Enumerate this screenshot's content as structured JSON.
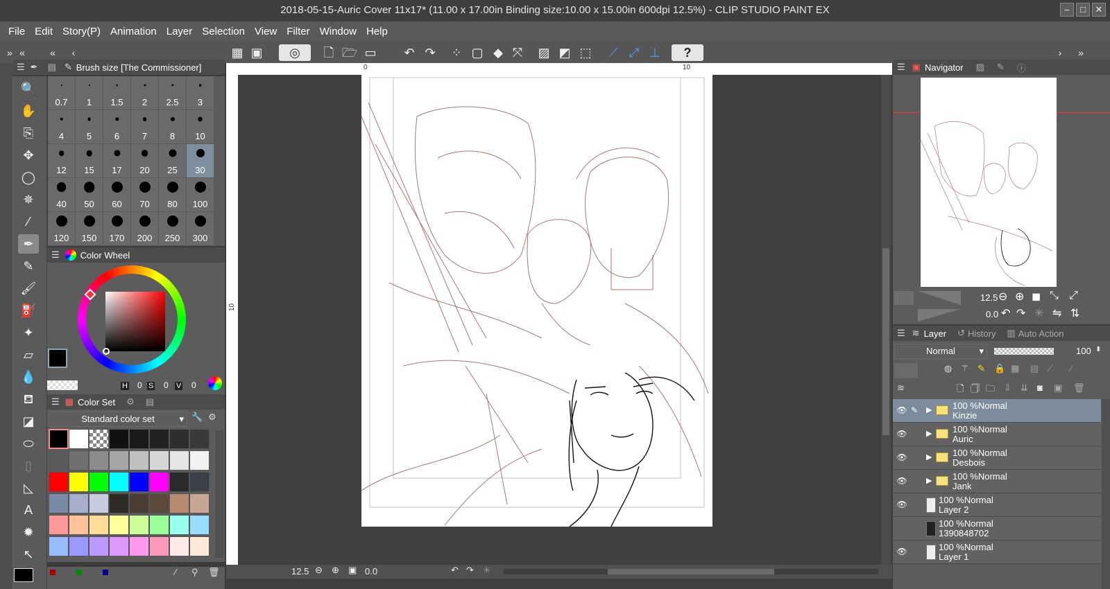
{
  "window": {
    "title": "2018-05-15-Auric Cover 11x17* (11.00 x 17.00in Binding size:10.00 x 15.00in 600dpi 12.5%)  - CLIP STUDIO PAINT EX"
  },
  "menu": [
    "File",
    "Edit",
    "Story(P)",
    "Animation",
    "Layer",
    "Selection",
    "View",
    "Filter",
    "Window",
    "Help"
  ],
  "brush_panel": {
    "title": "Brush size [The Commissioner]",
    "sizes": [
      "0.7",
      "1",
      "1.5",
      "2",
      "2.5",
      "3",
      "4",
      "5",
      "6",
      "7",
      "8",
      "10",
      "12",
      "15",
      "17",
      "20",
      "25",
      "30",
      "40",
      "50",
      "60",
      "70",
      "80",
      "100",
      "120",
      "150",
      "170",
      "200",
      "250",
      "300"
    ],
    "selected": "30"
  },
  "color_wheel": {
    "title": "Color Wheel",
    "h_label": "H",
    "h": "0",
    "s_label": "S",
    "s": "0",
    "v_label": "V",
    "v": "0",
    "main_color": "#000000",
    "sub_color": "#ffff99"
  },
  "color_set": {
    "title": "Color Set",
    "set_name": "Standard color set",
    "swatches": [
      "#000000",
      "#ffffff",
      "checker",
      "#111111",
      "#1a1a1a",
      "#222222",
      "#2e2e2e",
      "#3a3a3a",
      "#5a5a5a",
      "#707070",
      "#8c8c8c",
      "#a6a6a6",
      "#c0c0c0",
      "#d6d6d6",
      "#e6e6e6",
      "#f2f2f2",
      "#ff0000",
      "#ffff00",
      "#00ff00",
      "#00ffff",
      "#0000ff",
      "#ff00ff",
      "#2a2a2a",
      "#3a3f4a",
      "#7a8aa6",
      "#a6b0cc",
      "#c7cde0",
      "#2e2a26",
      "#4a3c30",
      "#5c4a3a",
      "#b88c72",
      "#c8a696",
      "#ff9999",
      "#ffc299",
      "#ffdd99",
      "#ffff99",
      "#ccff99",
      "#99ff99",
      "#99ffee",
      "#99ddff",
      "#99bbff",
      "#9999ff",
      "#bb99ff",
      "#dd99ff",
      "#ff99ee",
      "#ff99bb",
      "#ffeaea",
      "#ffe8d8"
    ]
  },
  "canvas": {
    "ruler_marks": [
      "0",
      "10"
    ],
    "vruler_mark": "10",
    "zoom": "12.5",
    "angle": "0.0"
  },
  "navigator": {
    "title": "Navigator",
    "zoom": "12.5",
    "angle": "0.0"
  },
  "layer_panel": {
    "tabs": [
      "Layer",
      "History",
      "Auto Action"
    ],
    "blend_mode": "Normal",
    "opacity": "100",
    "layers": [
      {
        "percent": "100 %",
        "mode": "Normal",
        "name": "Kinzie",
        "type": "folder",
        "visible": true,
        "selected": true
      },
      {
        "percent": "100 %",
        "mode": "Normal",
        "name": "Auric",
        "type": "folder",
        "visible": true,
        "selected": false
      },
      {
        "percent": "100 %",
        "mode": "Normal",
        "name": "Desbois",
        "type": "folder",
        "visible": true,
        "selected": false
      },
      {
        "percent": "100 %",
        "mode": "Normal",
        "name": "Jank",
        "type": "folder",
        "visible": true,
        "selected": false
      },
      {
        "percent": "100 %",
        "mode": "Normal",
        "name": "Layer 2",
        "type": "raster",
        "visible": true,
        "selected": false
      },
      {
        "percent": "100 %",
        "mode": "Normal",
        "name": "1390848702",
        "type": "image",
        "visible": false,
        "selected": false
      },
      {
        "percent": "100 %",
        "mode": "Normal",
        "name": "Layer 1",
        "type": "raster",
        "visible": true,
        "selected": false
      }
    ]
  },
  "icons": {
    "eye": "eye-icon",
    "folder": "folder-icon"
  }
}
